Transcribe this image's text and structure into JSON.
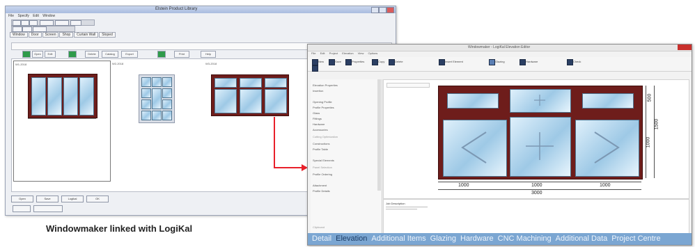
{
  "caption": "Windowmaker linked with LogiKal",
  "colors": {
    "frame": "#6e1d1b",
    "arrow": "#e8202a",
    "tab_bar": "#7ba6d2"
  },
  "left_window": {
    "title": "Elstein Product Library",
    "menu": [
      "File",
      "Specify",
      "Edit",
      "Window"
    ],
    "tabs": [
      "Window",
      "Door",
      "Screen",
      "Shop",
      "Curtain Wall",
      "Sloped"
    ],
    "controls": [
      "Open",
      "Edit",
      "Delete",
      "Catalog",
      "Export",
      "Print",
      "Help"
    ],
    "cards": [
      {
        "caption": "W1-2018"
      },
      {
        "caption": "W2-2018"
      },
      {
        "caption": "W3-2018"
      }
    ],
    "bottom_buttons": [
      "Open",
      "Save",
      "Logikal",
      "OK"
    ]
  },
  "right_window": {
    "title": "Windowmaker - LogiKal Elevation Editor",
    "menu": [
      "File",
      "Edit",
      "Project",
      "Elevation",
      "View",
      "Options"
    ],
    "ribbon": [
      "New",
      "Save",
      "Properties",
      "Copy",
      "Delete",
      "Insert Element",
      "Glazing",
      "Hardware",
      "Check"
    ],
    "sidebar": [
      "Elevation Properties",
      "Insertion",
      "Opening Profile",
      "Profile Properties",
      "Glass",
      "Fittings",
      "Hardware",
      "Accessories",
      "Cutting Optimization",
      "Constructions",
      "Profile Table",
      "Special Elements",
      "Panel Selection",
      "Profile Ordering",
      "Attachment",
      "Profile Details",
      "Clipboard"
    ],
    "dimensions": {
      "widths": [
        "1000",
        "1000",
        "1000"
      ],
      "total_width": "3000",
      "top_height": "500",
      "lower_height": "1000",
      "total_height": "1500"
    },
    "notes_title": "Job Description",
    "bottom_tabs": [
      "Detail",
      "Elevation",
      "Additional Items",
      "Glazing",
      "Hardware",
      "CNC Machining",
      "Additional Data",
      "Project Centre"
    ]
  }
}
